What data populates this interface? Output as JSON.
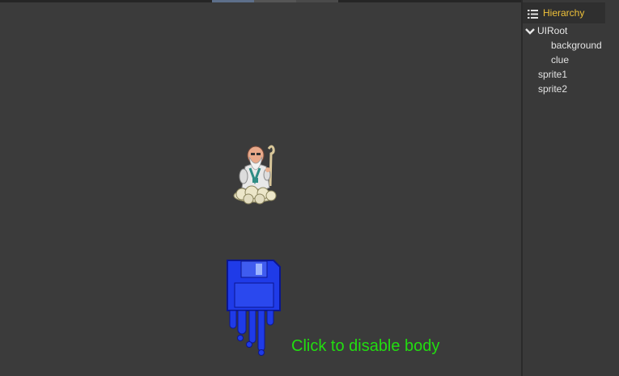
{
  "hierarchy": {
    "title": "Hierarchy",
    "icon": "list-icon",
    "root": {
      "label": "UIRoot",
      "expanded": true,
      "children": [
        "background",
        "clue"
      ]
    },
    "items": [
      "sprite1",
      "sprite2"
    ]
  },
  "scene": {
    "status_text": "Click to disable body",
    "status_color": "#22dd10",
    "sprites": [
      "sage-sprite",
      "floppy-disk-sprite"
    ]
  },
  "colors": {
    "background": "#3b3b3b",
    "panel": "#393939",
    "header_title": "#f0c23a"
  }
}
